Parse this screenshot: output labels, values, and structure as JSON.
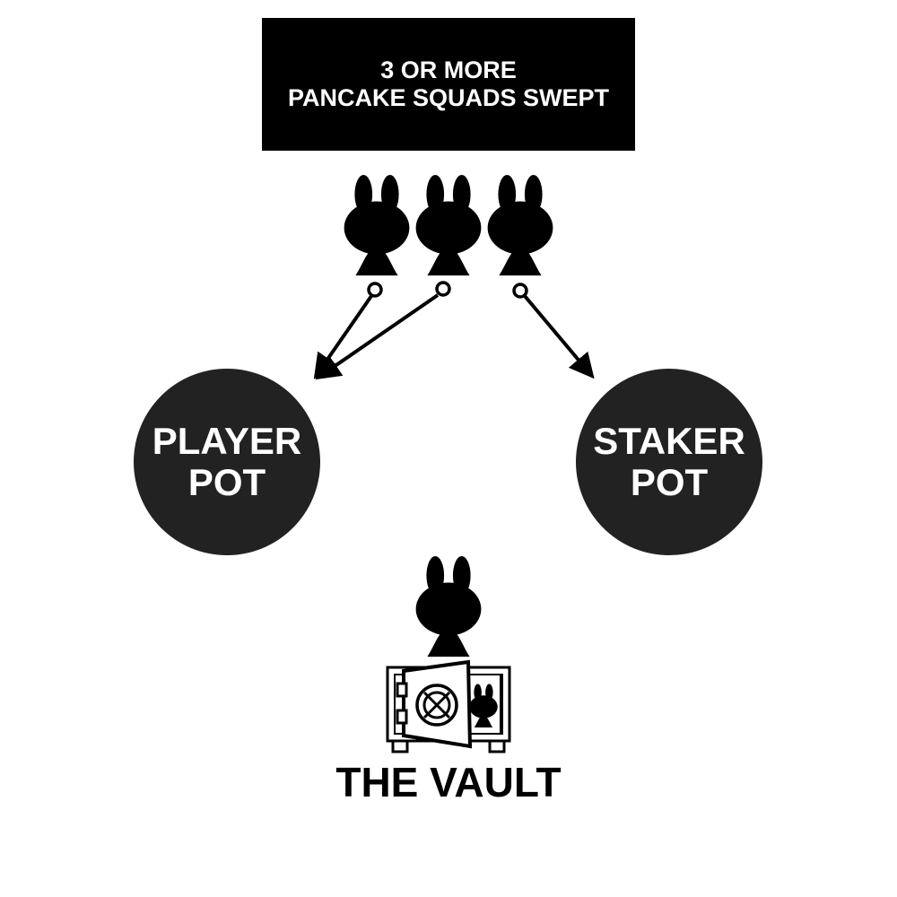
{
  "header": {
    "line1": "3 OR MORE",
    "line2": "PANCAKE SQUADS SWEPT"
  },
  "pots": {
    "player": {
      "line1": "PLAYER",
      "line2": "POT"
    },
    "staker": {
      "line1": "STAKER",
      "line2": "POT"
    }
  },
  "vault": {
    "label": "THE VAULT"
  },
  "icons": {
    "squad": "bunny-silhouette-icon",
    "vault": "vault-safe-icon",
    "connector": "arrow-icon"
  },
  "colors": {
    "banner_bg": "#000000",
    "banner_text": "#ffffff",
    "pot_bg": "#222222",
    "pot_text": "#ffffff",
    "ink": "#000000"
  }
}
